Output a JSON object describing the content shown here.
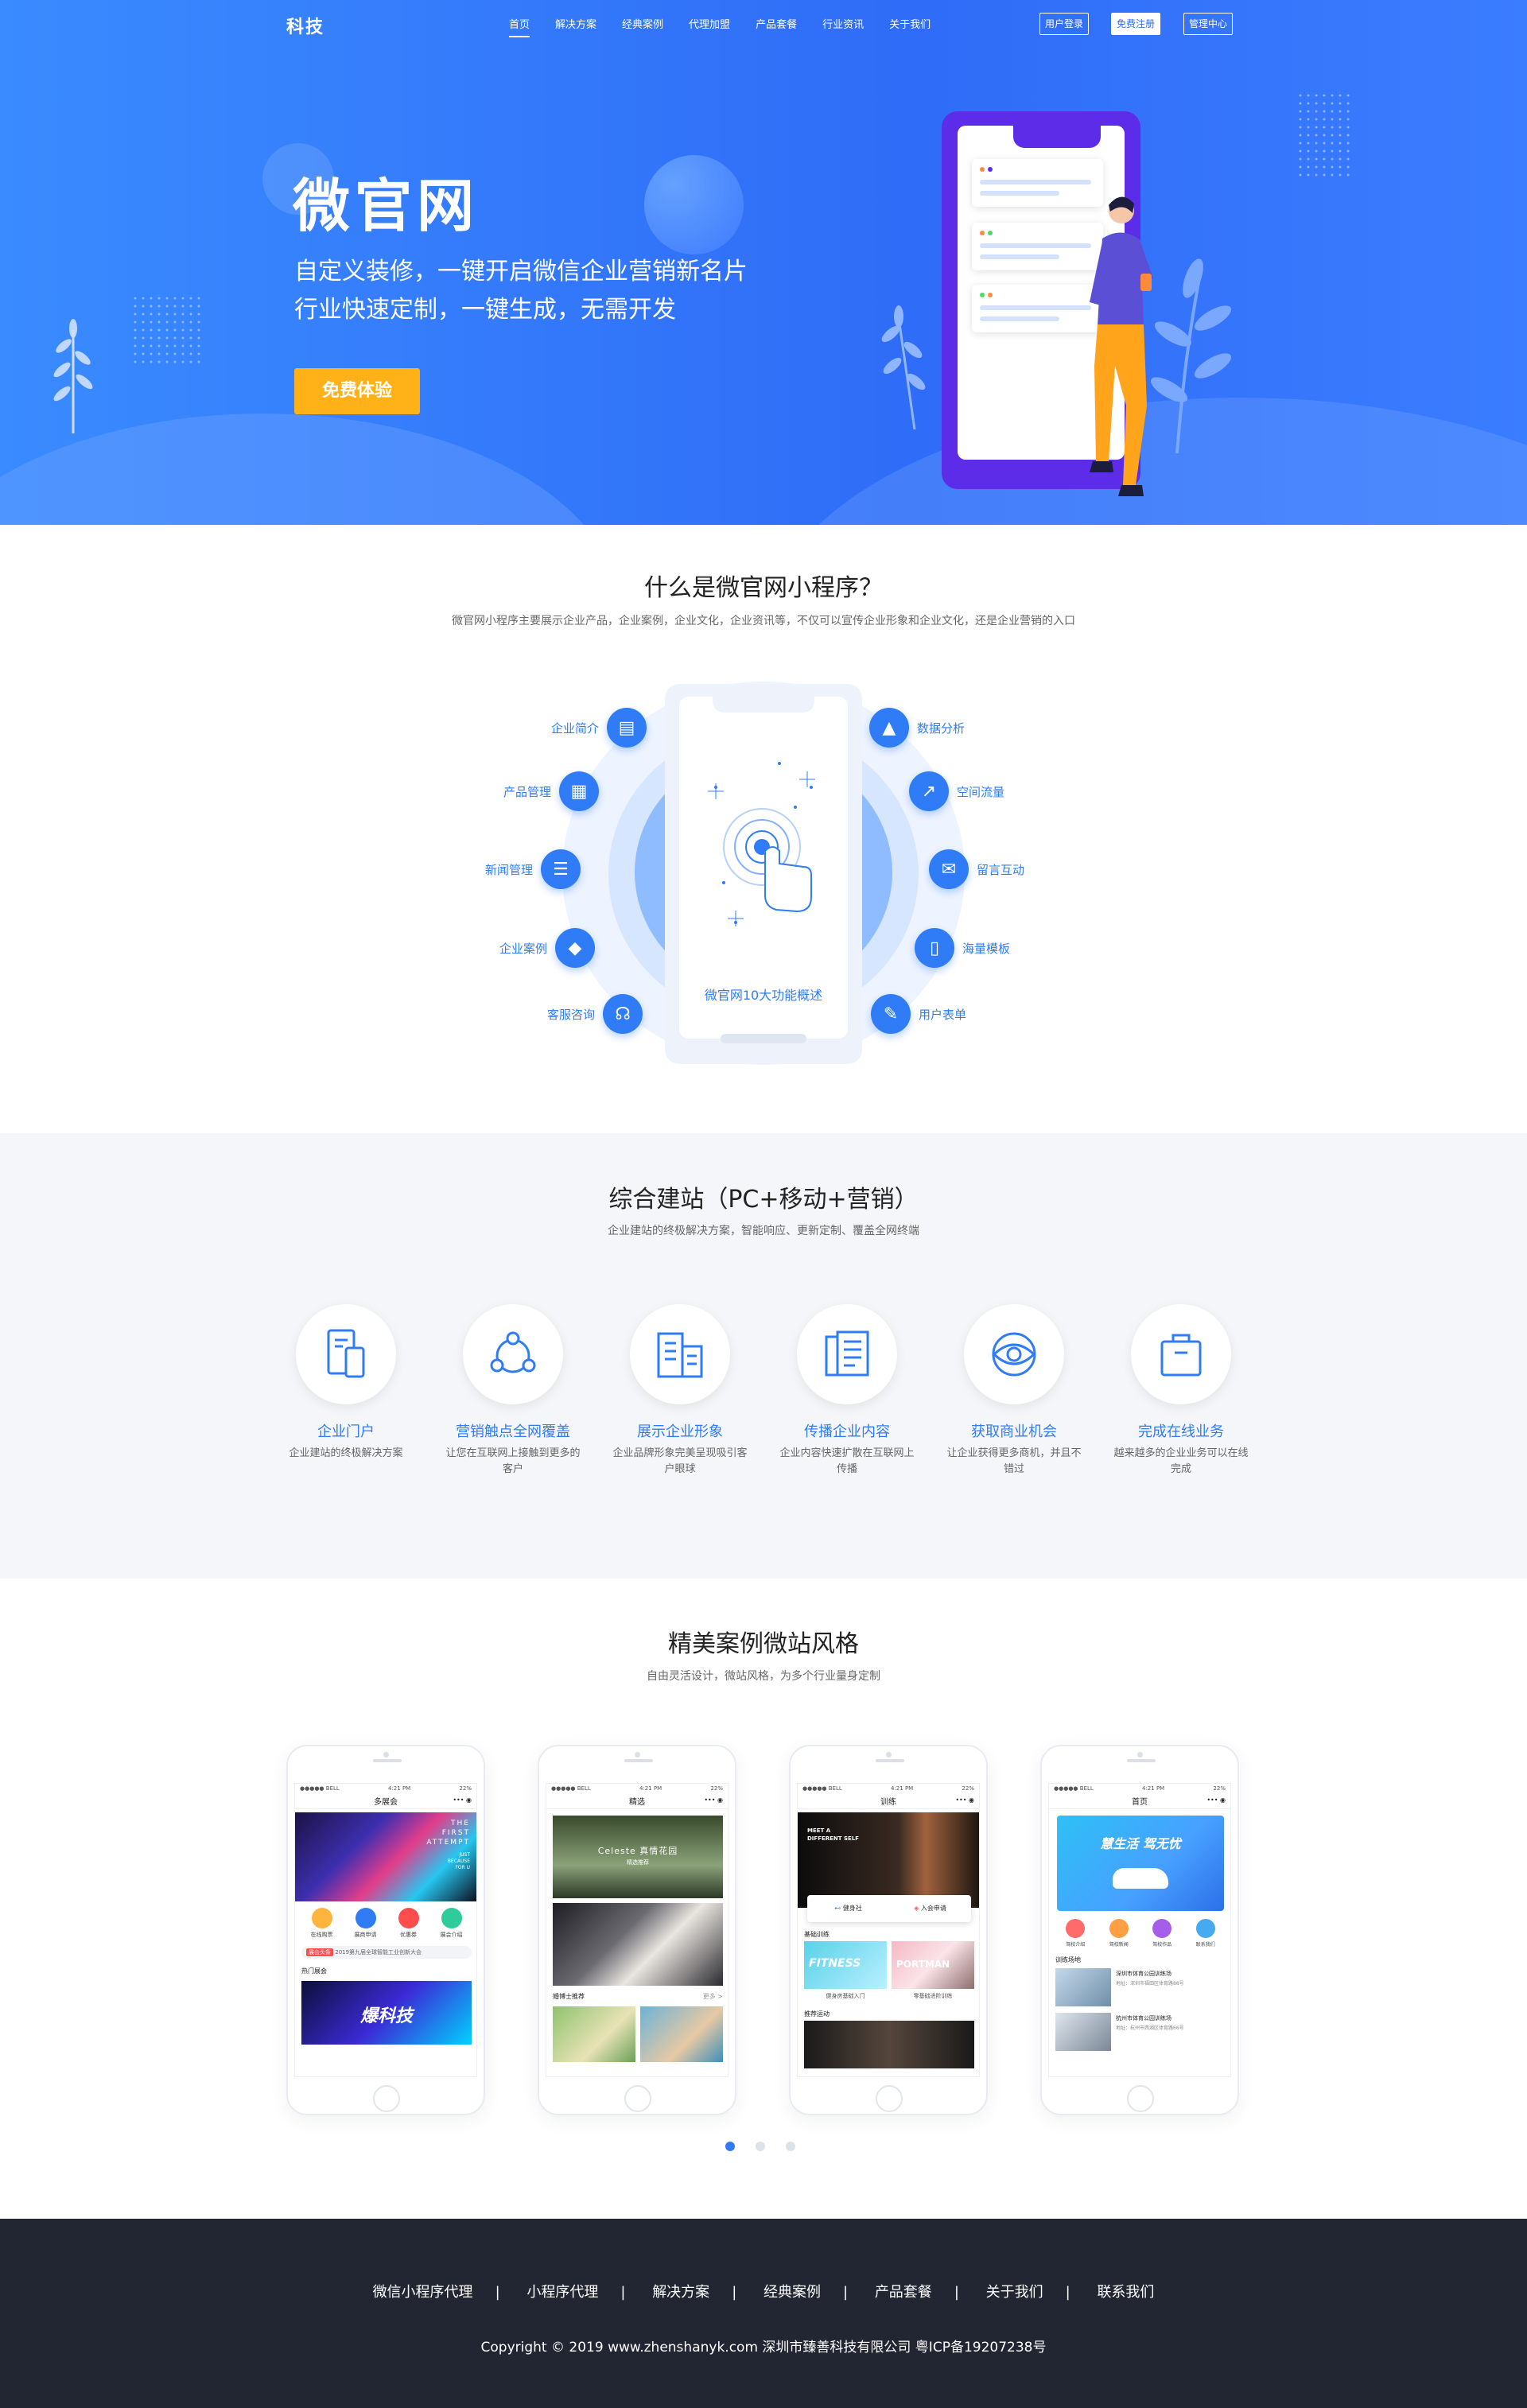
{
  "nav": {
    "logo": "科技",
    "menu": [
      "首页",
      "解决方案",
      "经典案例",
      "代理加盟",
      "产品套餐",
      "行业资讯",
      "关于我们"
    ],
    "login": "用户登录",
    "register": "免费注册",
    "admin": "管理中心"
  },
  "hero": {
    "title": "微官网",
    "line1": "自定义装修，一键开启微信企业营销新名片",
    "line2": "行业快速定制，一键生成，无需开发",
    "cta": "免费体验"
  },
  "about": {
    "title": "什么是微官网小程序？",
    "subtitle": "微官网小程序主要展示企业产品，企业案例，企业文化，企业资讯等，不仅可以宣传企业形象和企业文化，还是企业营销的入口",
    "caption": "微官网10大功能概述",
    "left_features": [
      {
        "label": "企业简介",
        "icon": "book-icon"
      },
      {
        "label": "产品管理",
        "icon": "grid-icon"
      },
      {
        "label": "新闻管理",
        "icon": "news-icon"
      },
      {
        "label": "企业案例",
        "icon": "cube-icon"
      },
      {
        "label": "客服咨询",
        "icon": "headset-icon"
      }
    ],
    "right_features": [
      {
        "label": "数据分析",
        "icon": "chart-icon"
      },
      {
        "label": "空间流量",
        "icon": "trend-icon"
      },
      {
        "label": "留言互动",
        "icon": "chat-icon"
      },
      {
        "label": "海量模板",
        "icon": "mobile-icon"
      },
      {
        "label": "用户表单",
        "icon": "form-icon"
      }
    ]
  },
  "site": {
    "title": "综合建站（PC+移动+营销）",
    "subtitle": "企业建站的终极解决方案，智能响应、更新定制、覆盖全网终端",
    "services": [
      {
        "name": "企业门户",
        "desc": "企业建站的终极解决方案",
        "icon": "devices-icon"
      },
      {
        "name": "营销触点全网覆盖",
        "desc": "让您在互联网上接触到更多的客户",
        "icon": "network-icon"
      },
      {
        "name": "展示企业形象",
        "desc": "企业品牌形象完美呈现吸引客户眼球",
        "icon": "building-icon"
      },
      {
        "name": "传播企业内容",
        "desc": "企业内容快速扩散在互联网上传播",
        "icon": "document-icon"
      },
      {
        "name": "获取商业机会",
        "desc": "让企业获得更多商机，并且不错过",
        "icon": "eye-icon"
      },
      {
        "name": "完成在线业务",
        "desc": "越来越多的企业业务可以在线完成",
        "icon": "bag-icon"
      }
    ]
  },
  "cases": {
    "title": "精美案例微站风格",
    "subtitle": "自由灵活设计，微站风格，为多个行业量身定制",
    "phones": [
      {
        "title": "多展会",
        "carrier": "●●●●● BELL",
        "time": "4:21 PM",
        "battery": "22%"
      },
      {
        "title": "精选",
        "carrier": "●●●●● BELL",
        "time": "4:21 PM",
        "battery": "22%"
      },
      {
        "title": "训练",
        "carrier": "●●●●● BELL",
        "time": "4:21 PM",
        "battery": "22%"
      },
      {
        "title": "首页",
        "carrier": "●●●●● BELL",
        "time": "4:21 PM",
        "battery": "22%"
      }
    ],
    "p1": {
      "banner_lines": [
        "THE",
        "FIRST",
        "ATTEMPT",
        "JUST",
        "BECAUSE",
        "FOR U"
      ],
      "icons": [
        "在线购票",
        "展商申请",
        "优惠券",
        "展会介绍"
      ],
      "notice_tag": "展会头条",
      "notice": "2019第九届全球智能工业创新大会",
      "hot": "热门展会",
      "banner2": "爆科技"
    },
    "p2": {
      "banner": "Celeste 真情花园",
      "banner_sub": "精选推荐",
      "list_title": "婚博士推荐",
      "more": "更多 >"
    },
    "p3": {
      "banner": "MEET A DIFFERENT SELF",
      "btn1": "健身社",
      "btn2": "入会申请",
      "sec1": "基础训练",
      "card1": "FITNESS",
      "card1_cap": "健身房基础入门",
      "card2": "PORTMAN",
      "card2_cap": "零基础进阶训练",
      "sec2": "推荐运动"
    },
    "p4": {
      "banner": "慧生活 驾无忧",
      "icons": [
        "驾校介绍",
        "驾校新闻",
        "驾校作品",
        "联系我们"
      ],
      "sec": "训练场地",
      "item1": "深圳市体育公园训练场",
      "item1_addr": "地址：深圳市福田区体育路88号",
      "item2": "杭州市体育公园训练场",
      "item2_addr": "地址：杭州市西湖区体育路66号"
    }
  },
  "footer": {
    "links": [
      "微信小程序代理",
      "小程序代理",
      "解决方案",
      "经典案例",
      "产品套餐",
      "关于我们",
      "联系我们"
    ],
    "separator": "|",
    "copyright": "Copyright  ©  2019 www.zhenshanyk.com  深圳市臻善科技有限公司  粤ICP备19207238号"
  },
  "colors": {
    "primary": "#2f7cf6",
    "hero_gradient": "#3a8bff",
    "cta": "#ffb117",
    "footer": "#222633",
    "illustration_phone": "#5c2ce8"
  }
}
